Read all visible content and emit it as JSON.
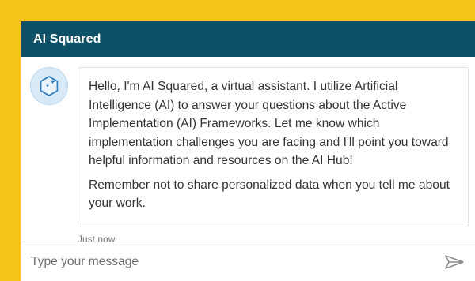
{
  "header": {
    "title": "AI Squared"
  },
  "message": {
    "paragraphs": [
      "Hello, I'm AI Squared, a virtual assistant. I utilize Artificial Intelligence (AI) to answer your questions about the Active Implementation (AI) Frameworks. Let me know which implementation challenges you are facing and I'll point you toward helpful information and resources on the AI Hub!",
      "Remember not to share personalized data when you tell me about your work."
    ],
    "timestamp": "Just now"
  },
  "composer": {
    "value": "",
    "placeholder": "Type your message"
  },
  "colors": {
    "frame": "#f5c518",
    "header": "#0e5166",
    "avatar_bg": "#d8eaf7",
    "avatar_icon": "#2b7bbf"
  },
  "icons": {
    "avatar": "hexagon-sparkle-icon",
    "send": "send-arrow-icon"
  }
}
